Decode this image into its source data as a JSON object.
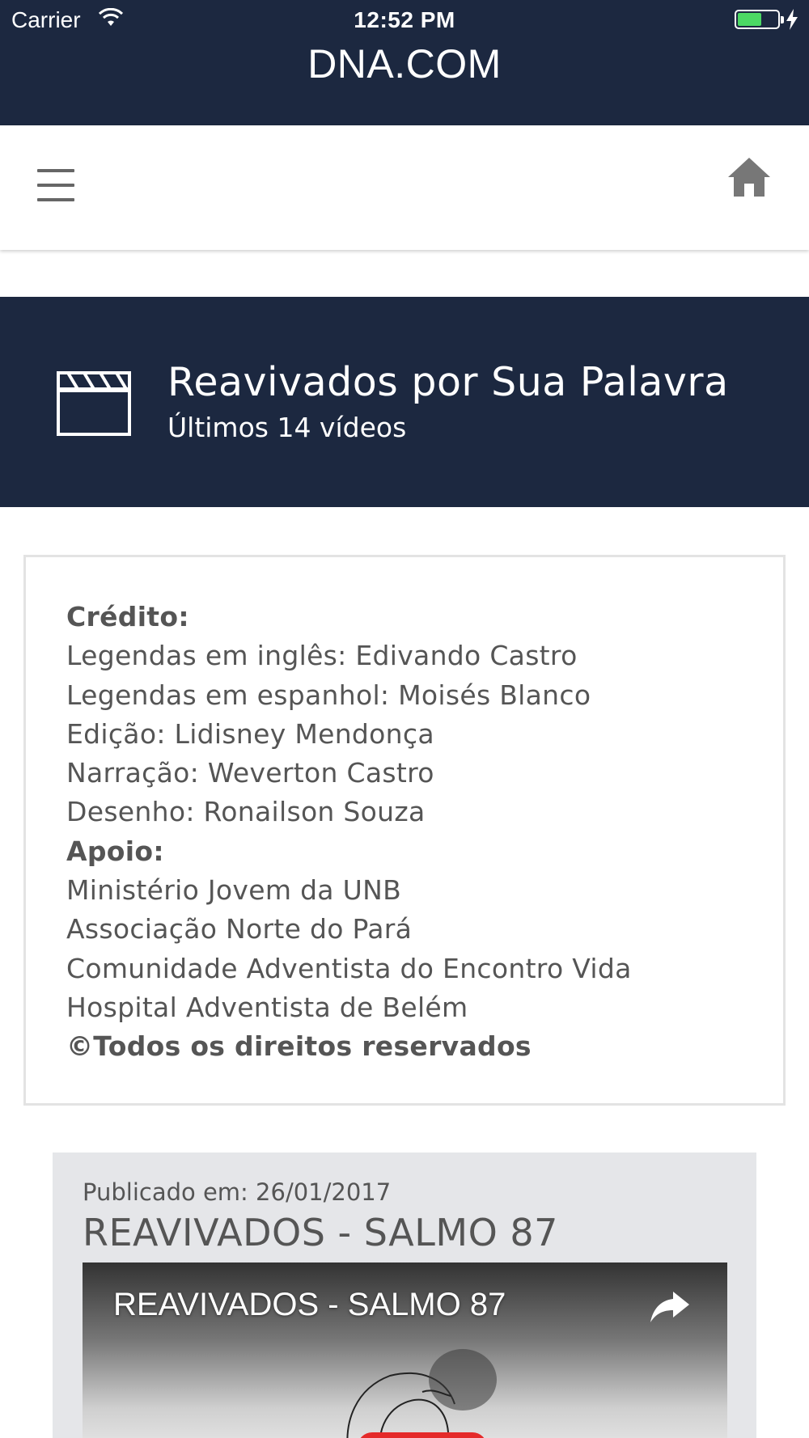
{
  "status_bar": {
    "carrier": "Carrier",
    "time": "12:52 PM",
    "battery_level": 0.6
  },
  "app": {
    "title": "DNA.COM"
  },
  "toolbar": {
    "menu_icon": "hamburger-menu-icon",
    "home_icon": "home-icon"
  },
  "banner": {
    "icon": "clapperboard-icon",
    "title": "Reavivados por Sua Palavra",
    "subtitle": "Últimos 14 vídeos"
  },
  "credits": {
    "lines": [
      "Crédito:",
      "Legendas em inglês: Edivando Castro",
      "Legendas em espanhol: Moisés Blanco",
      "Edição: Lidisney Mendonça",
      "Narração: Weverton Castro",
      "Desenho: Ronailson Souza",
      "Apoio:",
      "Ministério Jovem da UNB",
      "Associação Norte do Pará",
      "Comunidade Adventista do Encontro Vida",
      "Hospital Adventista de Belém",
      "©Todos os direitos reservados"
    ]
  },
  "video": {
    "published": "Publicado em: 26/01/2017",
    "title": "REAVIVADOS - SALMO 87",
    "player_title": "REAVIVADOS - SALMO 87",
    "share_icon": "share-icon",
    "play_icon": "play-button-icon"
  },
  "colors": {
    "navy": "#1c2840",
    "text_gray": "#555555",
    "card_bg": "#e5e6e9",
    "battery_green": "#4cd964",
    "play_red": "#e52a2a"
  }
}
